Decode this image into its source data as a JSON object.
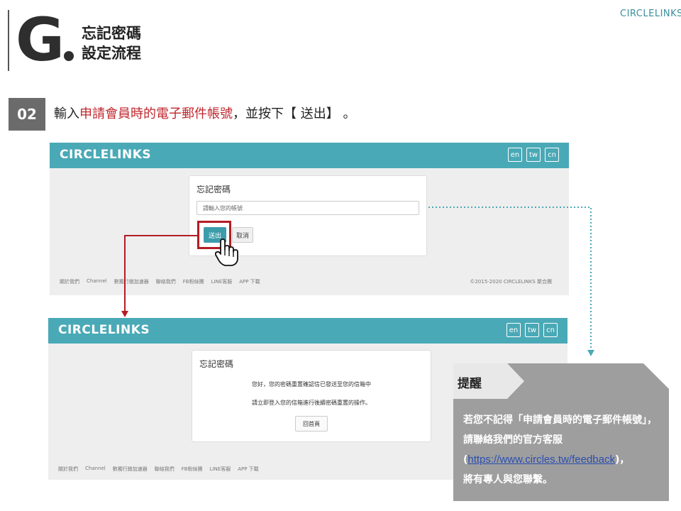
{
  "header": {
    "letter": "G",
    "title_line1": "忘記密碼",
    "title_line2": "設定流程",
    "logo": "CIRCLELINKS"
  },
  "step": {
    "number": "02",
    "text_before": "輸入",
    "text_highlight": "申請會員時的電子郵件帳號",
    "text_after": "，並按下【 送出】 。"
  },
  "screen1": {
    "brand": "CIRCLELINKS",
    "langs": [
      "en",
      "tw",
      "cn"
    ],
    "card_title": "忘記密碼",
    "input_placeholder": "請輸入您的帳號",
    "send_label": "送出",
    "cancel_label": "取消",
    "footer_links": [
      "關於我們",
      "Channel",
      "數獨行銷加速器",
      "聯絡我們",
      "FB粉絲團",
      "LINE客服",
      "APP 下載"
    ],
    "copyright": "©2015-2020 CIRCLELINKS 聚合團"
  },
  "screen2": {
    "brand": "CIRCLELINKS",
    "langs": [
      "en",
      "tw",
      "cn"
    ],
    "card_title": "忘記密碼",
    "message1": "您好，您的密碼重置確認信已發送至您的信箱中",
    "message2": "請立即登入您的信箱進行後續密碼重置的操作。",
    "home_label": "回首頁",
    "footer_links": [
      "關於我們",
      "Channel",
      "數獨行銷加速器",
      "聯絡我們",
      "FB粉絲團",
      "LINE客服",
      "APP 下載"
    ]
  },
  "reminder": {
    "label": "提醒",
    "line1": "若您不記得「申請會員時的電子郵件帳號」，請聯絡我們的官方客服",
    "paren_open": "(",
    "link": "https://www.circles.tw/feedback",
    "paren_close": ")，",
    "line3": "將有專人與您聯繫。"
  },
  "colors": {
    "teal": "#4aa9b6",
    "highlight_red": "#c0272d",
    "step_badge": "#6b6b6b",
    "reminder_bg": "#9e9e9e"
  }
}
